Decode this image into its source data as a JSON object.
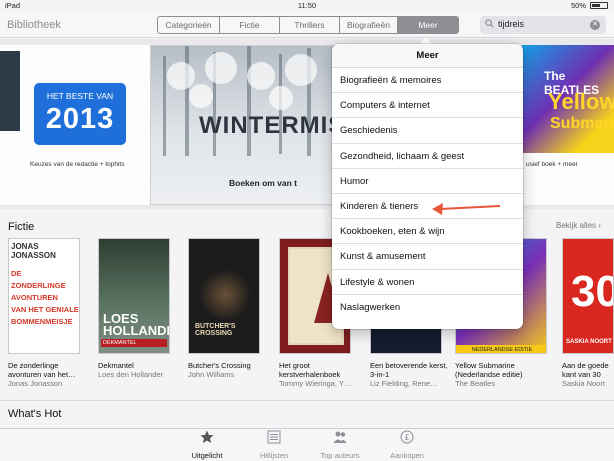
{
  "status_bar": {
    "device": "iPad",
    "time": "11:50",
    "battery": "50%",
    "battery_level": 0.5
  },
  "nav": {
    "title": "Bibliotheek",
    "segments": [
      "Categorieën",
      "Fictie",
      "Thrillers",
      "Biografieën",
      "Meer"
    ],
    "active_segment": "Meer",
    "search_value": "tijdreis"
  },
  "banner": {
    "left": {
      "badge_line1": "HET BESTE VAN",
      "badge_year": "2013",
      "caption": "Keuzes van de redactie + tophits"
    },
    "middle": {
      "title": "WINTERMIS",
      "caption": "Boeken om van t"
    },
    "right": {
      "art_name": "The BEATLES",
      "art_word1": "Yellow",
      "art_word2": "Submarine",
      "caption": "usief boek + meer"
    }
  },
  "fictie": {
    "title": "Fictie",
    "see_all": "Bekijk alles",
    "books": [
      {
        "title": "De zonderlinge avonturen van het…",
        "author": "Jonas Jonasson",
        "cover": {
          "author": "JONAS JONASSON",
          "lines": [
            "DE",
            "ZONDERLINGE",
            "AVONTUREN",
            "VAN HET GENIALE",
            "BOMMENMEISJE"
          ]
        }
      },
      {
        "title": "Dekmantel",
        "author": "Loes den Hollander",
        "cover": {
          "name_line1": "LOES",
          "name_line2": "HOLLANDER",
          "band": "DEKMANTEL"
        }
      },
      {
        "title": "Butcher's Crossing",
        "author": "John Williams",
        "cover": {
          "text": "BUTCHER'S CROSSING"
        }
      },
      {
        "title": "Het groot kerstverhalenboek",
        "author": "Tommy Wieringa, Y…",
        "cover": {}
      },
      {
        "title": "Een betoverende kerst, 3-in-1",
        "author": "Liz Fielding, Rene…",
        "cover": {}
      },
      {
        "title": "Yellow Submarine (Nederlandse editie)",
        "author": "The Beatles",
        "cover": {
          "band": "NEDERLANDSE EDITIE"
        }
      },
      {
        "title": "Aan de goede kant van 30",
        "author": "Saskia Noort",
        "cover": {
          "number": "30",
          "name": "SASKIA NOORT"
        }
      }
    ]
  },
  "whats_hot": {
    "title": "What's Hot"
  },
  "tabbar": {
    "tabs": [
      {
        "label": "Uitgelicht",
        "icon": "star-icon",
        "active": true
      },
      {
        "label": "Hitlijsten",
        "icon": "list-icon",
        "active": false
      },
      {
        "label": "Top auteurs",
        "icon": "people-icon",
        "active": false
      },
      {
        "label": "Aankopen",
        "icon": "purchases-icon",
        "active": false
      }
    ]
  },
  "popover": {
    "title": "Meer",
    "items": [
      "Biografieën & memoires",
      "Computers & internet",
      "Geschiedenis",
      "Gezondheid, lichaam & geest",
      "Humor",
      "Kinderen & tieners",
      "Kookboeken, eten & wijn",
      "Kunst & amusement",
      "Lifestyle & wonen",
      "Naslagwerken"
    ],
    "highlighted_item": "Kinderen & tieners"
  },
  "colors": {
    "accent_blue": "#1e6fd9",
    "annotation_arrow": "#e8573a",
    "segment_active": "#8e8e93"
  }
}
